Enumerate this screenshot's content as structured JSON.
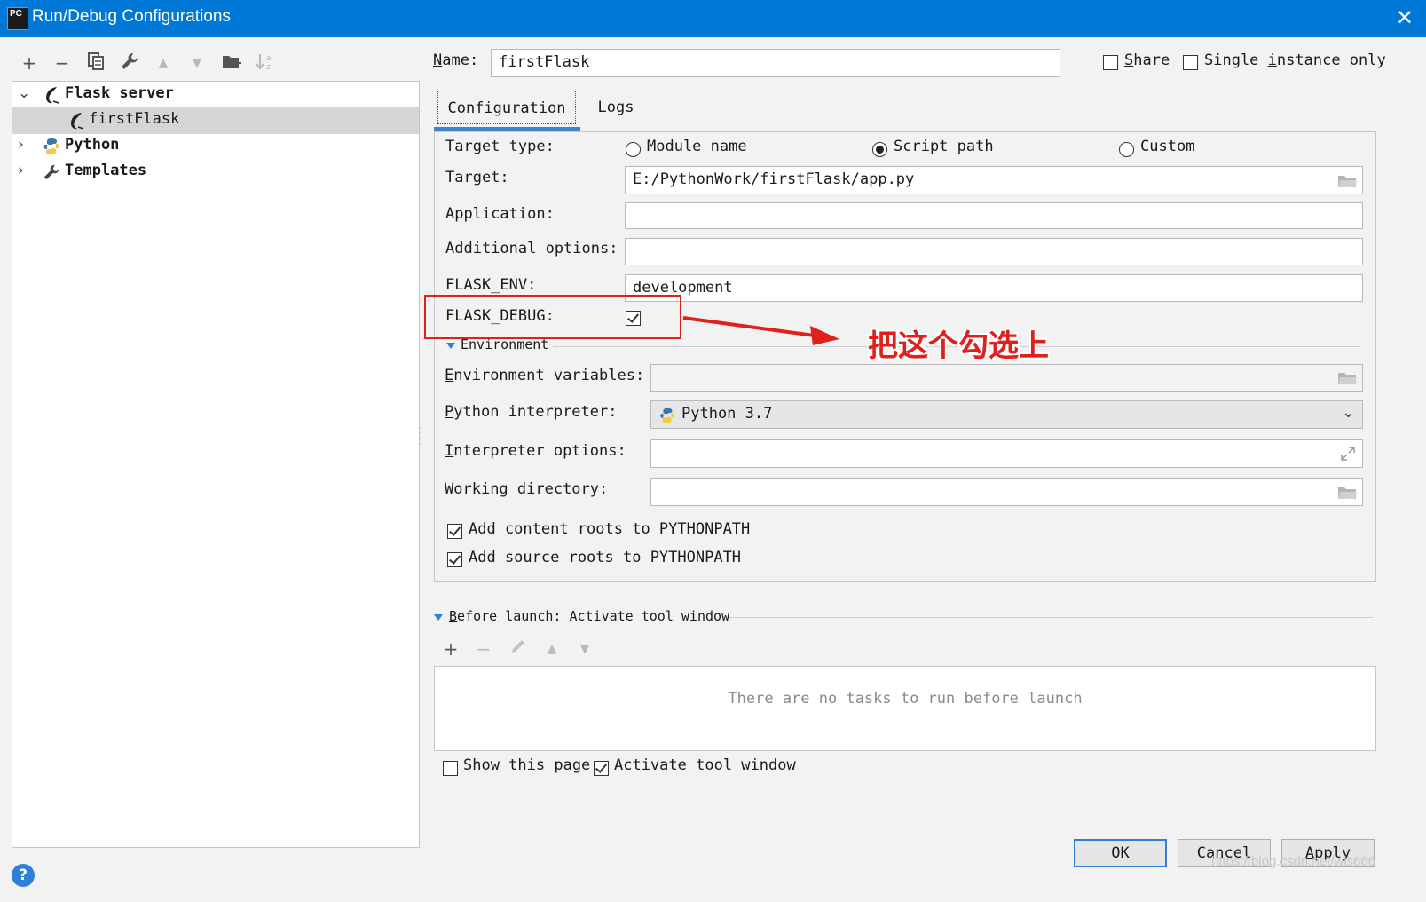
{
  "window": {
    "title": "Run/Debug Configurations",
    "app_icon_text": "PC"
  },
  "toolbar": {
    "add": "+",
    "remove": "−",
    "copy": "⧉",
    "edit": "🔧",
    "up": "▲",
    "down": "▼",
    "folder": "📁",
    "sort": "↓ᵃz"
  },
  "tree": {
    "items": [
      {
        "label": "Flask server",
        "expanded": true,
        "bold": true
      },
      {
        "label": "firstFlask",
        "selected": true
      },
      {
        "label": "Python",
        "expanded": false,
        "bold": true
      },
      {
        "label": "Templates",
        "expanded": false,
        "bold": true
      }
    ]
  },
  "header": {
    "name_label": "ame:",
    "name_mnemonic": "N",
    "name_value": "firstFlask",
    "share_label": "hare",
    "share_mnemonic": "S",
    "share_checked": false,
    "single_label_pre": "Single ",
    "single_mnemonic": "i",
    "single_label_post": "nstance only",
    "single_checked": false
  },
  "tabs": [
    {
      "label": "Configuration",
      "active": true
    },
    {
      "label": "Logs",
      "active": false
    }
  ],
  "config": {
    "target_type_label": "Target type:",
    "target_type_options": [
      "Module name",
      "Script path",
      "Custom"
    ],
    "target_type_selected": "Script path",
    "target_label": "Target:",
    "target_value": "E:/PythonWork/firstFlask/app.py",
    "application_label": "Application:",
    "application_value": "",
    "additional_label": "Additional options:",
    "additional_value": "",
    "flask_env_label": "FLASK_ENV:",
    "flask_env_value": "development",
    "flask_debug_label": "FLASK_DEBUG:",
    "flask_debug_checked": true,
    "environment_header": "Environment",
    "env_vars_mnemonic": "E",
    "env_vars_label": "nvironment variables:",
    "env_vars_value": "",
    "interpreter_mnemonic": "P",
    "interpreter_label": "ython interpreter:",
    "interpreter_value": "Python 3.7",
    "interp_options_mnemonic": "I",
    "interp_options_label": "nterpreter options:",
    "interp_options_value": "",
    "working_dir_mnemonic": "W",
    "working_dir_label": "orking directory:",
    "working_dir_value": "",
    "content_roots_label": "Add content roots to PYTHONPATH",
    "content_roots_checked": true,
    "source_roots_label": "Add source roots to PYTHONPATH",
    "source_roots_checked": true
  },
  "before_launch": {
    "mnemonic": "B",
    "header": "efore launch: Activate tool window",
    "empty_text": "There are no tasks to run before launch",
    "show_page_label": "Show this page",
    "show_page_checked": false,
    "activate_label": "Activate tool window",
    "activate_checked": true
  },
  "buttons": {
    "ok": "OK",
    "cancel": "Cancel",
    "apply_mnemonic": "A",
    "apply_rest": "pply",
    "help": "?"
  },
  "annotation": {
    "text": "把这个勾选上",
    "color": "#e0201c"
  },
  "watermark": "https://blog.csdn.net/wls666",
  "colors": {
    "titlebar": "#0078d7",
    "accent": "#2f7fd8",
    "selection": "#d5d5d5",
    "annotation": "#e0201c"
  }
}
